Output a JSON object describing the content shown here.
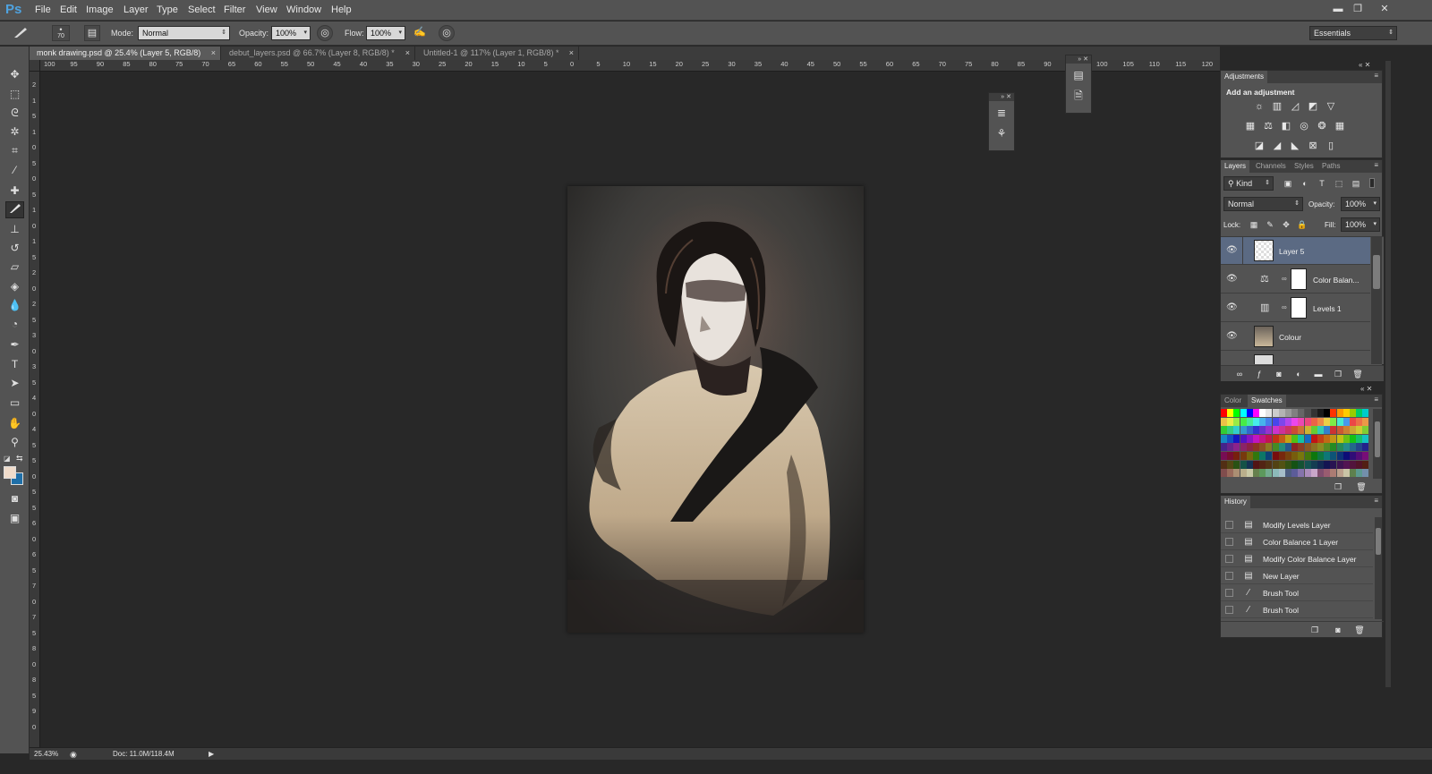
{
  "app": {
    "logo": "Ps"
  },
  "menu": [
    "File",
    "Edit",
    "Image",
    "Layer",
    "Type",
    "Select",
    "Filter",
    "View",
    "Window",
    "Help"
  ],
  "window_controls": {
    "minimize": "▬",
    "restore": "❐",
    "close": "✕"
  },
  "options": {
    "brush_size": "70",
    "mode_label": "Mode:",
    "mode_value": "Normal",
    "opacity_label": "Opacity:",
    "opacity_value": "100%",
    "flow_label": "Flow:",
    "flow_value": "100%",
    "workspace": "Essentials"
  },
  "doc_tabs": [
    {
      "title": "monk drawing.psd @ 25.4% (Layer 5, RGB/8)",
      "close": "×"
    },
    {
      "title": "debut_layers.psd @ 66.7% (Layer 8, RGB/8) *",
      "close": "×"
    },
    {
      "title": "Untitled-1 @ 117% (Layer 1, RGB/8) *",
      "close": "×"
    }
  ],
  "hruler_ticks": [
    "100",
    "95",
    "90",
    "85",
    "80",
    "75",
    "70",
    "65",
    "60",
    "55",
    "50",
    "45",
    "40",
    "35",
    "30",
    "25",
    "20",
    "15",
    "10",
    "5",
    "0",
    "5",
    "10",
    "15",
    "20",
    "25",
    "30",
    "35",
    "40",
    "45",
    "50",
    "55",
    "60",
    "65",
    "70",
    "75",
    "80",
    "85",
    "90",
    "95",
    "100",
    "105",
    "110",
    "115",
    "120"
  ],
  "vruler_ticks": [
    "2",
    "1",
    "5",
    "1",
    "0",
    "5",
    "0",
    "5",
    "1",
    "0",
    "1",
    "5",
    "2",
    "0",
    "2",
    "5",
    "3",
    "0",
    "3",
    "5",
    "4",
    "0",
    "4",
    "5",
    "5",
    "0",
    "5",
    "5",
    "6",
    "0",
    "6",
    "5",
    "7",
    "0",
    "7",
    "5",
    "8",
    "0",
    "8",
    "5",
    "9",
    "0"
  ],
  "adjustments": {
    "tab": "Adjustments",
    "heading": "Add an adjustment"
  },
  "layers_panel": {
    "tabs": [
      "Layers",
      "Channels",
      "Styles",
      "Paths"
    ],
    "filter_kind": "Kind",
    "blend_mode": "Normal",
    "opacity_label": "Opacity:",
    "opacity_value": "100%",
    "lock_label": "Lock:",
    "fill_label": "Fill:",
    "fill_value": "100%",
    "layers": [
      {
        "name": "Layer 5",
        "selected": true
      },
      {
        "name": "Color Balan...",
        "selected": false
      },
      {
        "name": "Levels 1",
        "selected": false
      },
      {
        "name": "Colour",
        "selected": false
      }
    ]
  },
  "color_panel": {
    "tabs": [
      "Color",
      "Swatches"
    ]
  },
  "history_panel": {
    "tab": "History",
    "items": [
      "Modify Levels Layer",
      "Color Balance 1 Layer",
      "Modify Color Balance Layer",
      "New Layer",
      "Brush Tool",
      "Brush Tool"
    ]
  },
  "status": {
    "zoom": "25.43%",
    "doc": "Doc: 11.0M/118.4M"
  },
  "colors": {
    "accent": "#4fa3e0",
    "selected_layer": "#5b6a83",
    "foreground": "#f0dccb",
    "background": "#1f6fa8"
  }
}
